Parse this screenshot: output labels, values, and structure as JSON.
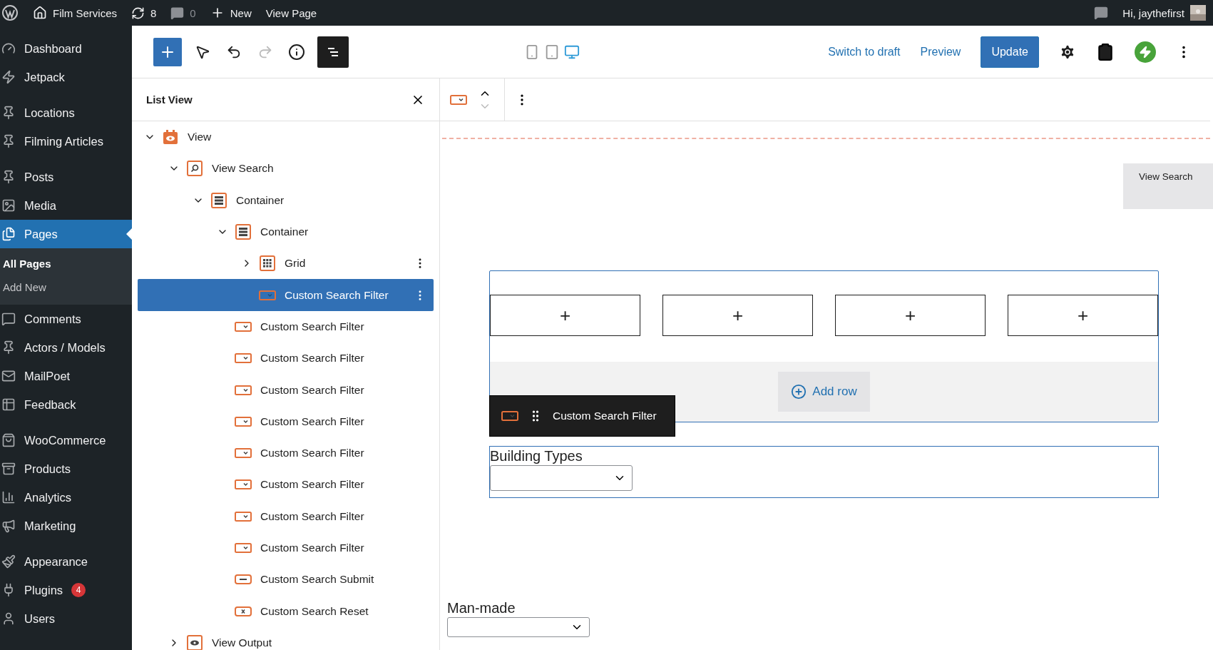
{
  "admin_bar": {
    "site_title": "Film Services",
    "updates": "8",
    "comments": "0",
    "new_label": "New",
    "view_page": "View Page",
    "greeting": "Hi, jaythefirst"
  },
  "sidebar": {
    "groups": [
      [
        {
          "label": "Dashboard",
          "selected": false
        },
        {
          "label": "Jetpack",
          "selected": false
        }
      ],
      [
        {
          "label": "Locations",
          "selected": false
        },
        {
          "label": "Filming Articles",
          "selected": false
        }
      ],
      [
        {
          "label": "Posts",
          "selected": false
        },
        {
          "label": "Media",
          "selected": false
        },
        {
          "label": "Pages",
          "selected": true,
          "children": [
            {
              "label": "All Pages",
              "selected": true
            },
            {
              "label": "Add New",
              "selected": false
            }
          ]
        },
        {
          "label": "Comments",
          "selected": false
        },
        {
          "label": "Actors / Models",
          "selected": false
        },
        {
          "label": "MailPoet",
          "selected": false
        },
        {
          "label": "Feedback",
          "selected": false
        }
      ],
      [
        {
          "label": "WooCommerce",
          "selected": false
        },
        {
          "label": "Products",
          "selected": false
        },
        {
          "label": "Analytics",
          "selected": false
        },
        {
          "label": "Marketing",
          "selected": false
        }
      ],
      [
        {
          "label": "Appearance",
          "selected": false
        },
        {
          "label": "Plugins",
          "selected": false,
          "badge": "4"
        },
        {
          "label": "Users",
          "selected": false
        }
      ]
    ]
  },
  "editor_header": {
    "list_view_open": true,
    "redo_disabled": true,
    "devices": [
      {
        "kind": "mobile",
        "selected": false
      },
      {
        "kind": "tablet",
        "selected": false
      },
      {
        "kind": "desktop",
        "selected": true
      }
    ],
    "switch_to_draft": "Switch to draft",
    "preview": "Preview",
    "update": "Update"
  },
  "list_view": {
    "title": "List View",
    "items": [
      {
        "label": "View",
        "kind": "view",
        "expanded": true,
        "selected": false,
        "children": [
          {
            "label": "View Search",
            "kind": "search",
            "expanded": true,
            "selected": false,
            "children": [
              {
                "label": "Container",
                "kind": "container",
                "expanded": true,
                "selected": false,
                "children": [
                  {
                    "label": "Container",
                    "kind": "container",
                    "expanded": true,
                    "selected": false,
                    "children": [
                      {
                        "label": "Grid",
                        "kind": "grid",
                        "expanded": false,
                        "selected": false,
                        "options": true
                      },
                      {
                        "label": "Custom Search Filter",
                        "kind": "filter",
                        "selected": true,
                        "options": true
                      }
                    ]
                  },
                  {
                    "label": "Custom Search Filter",
                    "kind": "filter",
                    "selected": false
                  },
                  {
                    "label": "Custom Search Filter",
                    "kind": "filter",
                    "selected": false
                  },
                  {
                    "label": "Custom Search Filter",
                    "kind": "filter",
                    "selected": false
                  },
                  {
                    "label": "Custom Search Filter",
                    "kind": "filter",
                    "selected": false
                  },
                  {
                    "label": "Custom Search Filter",
                    "kind": "filter",
                    "selected": false
                  },
                  {
                    "label": "Custom Search Filter",
                    "kind": "filter",
                    "selected": false
                  },
                  {
                    "label": "Custom Search Filter",
                    "kind": "filter",
                    "selected": false
                  },
                  {
                    "label": "Custom Search Filter",
                    "kind": "filter",
                    "selected": false
                  },
                  {
                    "label": "Custom Search Submit",
                    "kind": "submit",
                    "selected": false
                  },
                  {
                    "label": "Custom Search Reset",
                    "kind": "reset",
                    "selected": false
                  }
                ]
              }
            ]
          },
          {
            "label": "View Output",
            "kind": "output",
            "expanded": false,
            "selected": false
          }
        ]
      }
    ]
  },
  "canvas": {
    "view_search_tag": "View Search",
    "grid": {
      "cells": [
        "+",
        "+",
        "+",
        "+"
      ],
      "add_row": "Add row"
    },
    "floating_toolbar": {
      "label": "Custom Search Filter"
    },
    "filters": [
      {
        "label": "Building Types",
        "selected": true
      },
      {
        "label": "Man-made",
        "selected": false
      }
    ]
  }
}
